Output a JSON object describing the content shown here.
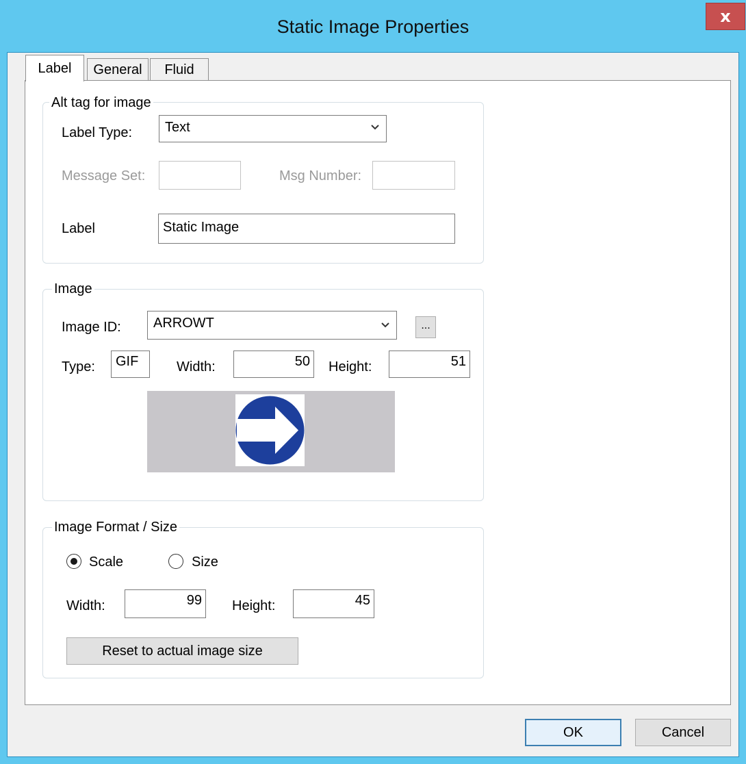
{
  "window": {
    "title": "Static Image Properties",
    "close_glyph": "x"
  },
  "tabs": [
    {
      "label": "Label",
      "active": true
    },
    {
      "label": "General",
      "active": false
    },
    {
      "label": "Fluid",
      "active": false
    }
  ],
  "alt_tag_group": {
    "legend": "Alt tag for image",
    "label_type_label": "Label Type:",
    "label_type_value": "Text",
    "message_set_label": "Message Set:",
    "message_set_value": "",
    "msg_number_label": "Msg Number:",
    "msg_number_value": "",
    "label_label": "Label",
    "label_value": "Static Image"
  },
  "image_group": {
    "legend": "Image",
    "image_id_label": "Image ID:",
    "image_id_value": "ARROWT",
    "browse_label": "...",
    "type_label": "Type:",
    "type_value": "GIF",
    "width_label": "Width:",
    "width_value": "50",
    "height_label": "Height:",
    "height_value": "51",
    "preview_icon": "arrow-right-circle-icon",
    "preview_colors": {
      "background": "#c8c6ca",
      "circle": "#1d3f9c",
      "arrow": "#ffffff"
    }
  },
  "format_group": {
    "legend": "Image Format / Size",
    "scale_label": "Scale",
    "size_label": "Size",
    "selected": "Scale",
    "width_label": "Width:",
    "width_value": "99",
    "height_label": "Height:",
    "height_value": "45",
    "reset_label": "Reset to actual image size"
  },
  "buttons": {
    "ok": "OK",
    "cancel": "Cancel"
  },
  "colors": {
    "titlebar": "#5fc8ef",
    "close": "#c75050",
    "default_button_border": "#3c7fb1"
  }
}
